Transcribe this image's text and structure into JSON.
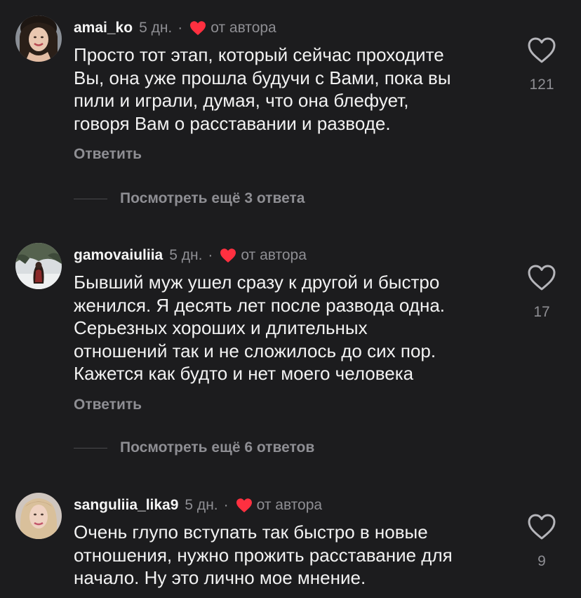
{
  "colors": {
    "background": "#1c1c1e",
    "primary_text": "#f2f2f2",
    "secondary_text": "#8e8e93",
    "author_heart": "#ff3040"
  },
  "icons": {
    "like": "heart-outline-icon",
    "author_like": "heart-filled-icon"
  },
  "comments": [
    {
      "username": "amai_ko",
      "time": "5 дн.",
      "separator": "·",
      "author_label": "от автора",
      "lines": [
        "Просто тот этап, который сейчас проходите",
        "Вы, она уже прошла будучи с Вами, пока вы",
        "пили и играли, думая, что она блефует,",
        "говоря Вам о расставании и разводе."
      ],
      "reply_label": "Ответить",
      "more_replies": "Посмотреть ещё 3 ответа",
      "likes": "121"
    },
    {
      "username": "gamovaiuliia",
      "time": "5 дн.",
      "separator": "·",
      "author_label": "от автора",
      "lines": [
        "Бывший муж ушел сразу к другой и быстро",
        "женился. Я десять лет после развода одна.",
        "Серьезных хороших и длительных",
        "отношений так и не сложилось до сих пор.",
        "Кажется как будто и нет моего человека"
      ],
      "reply_label": "Ответить",
      "more_replies": "Посмотреть ещё 6 ответов",
      "likes": "17"
    },
    {
      "username": "sanguliia_lika9",
      "time": "5 дн.",
      "separator": "·",
      "author_label": "от автора",
      "lines": [
        "Очень глупо вступать так быстро в новые",
        "отношения, нужно прожить расставание для",
        "начало. Ну это лично мое мнение."
      ],
      "likes": "9"
    }
  ]
}
